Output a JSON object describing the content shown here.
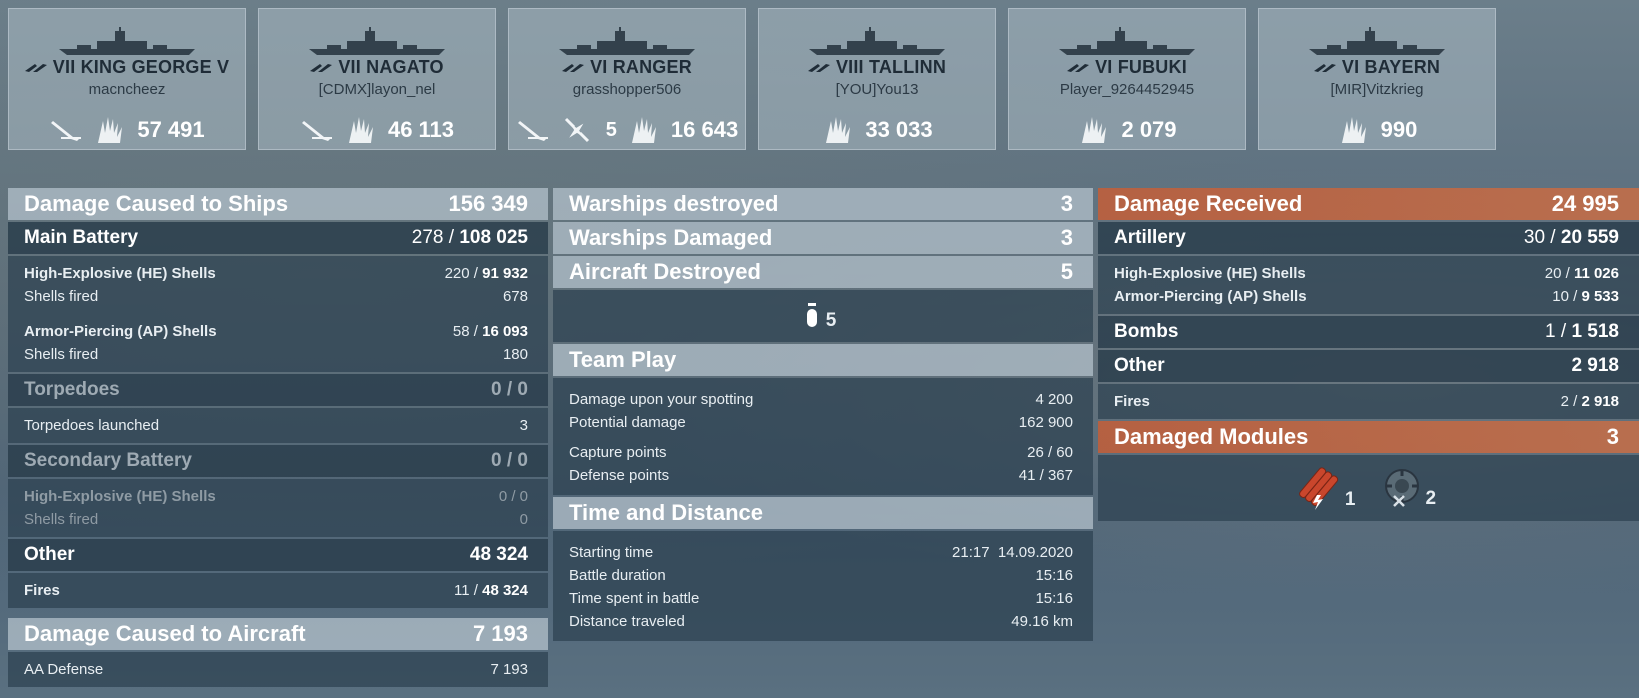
{
  "ships": [
    {
      "tier": "VII",
      "name": "KING GEORGE V",
      "player": "macncheez",
      "ribbons": [
        "torpedo-ribbon-icon",
        "fire-ribbon-icon"
      ],
      "damage": "57 491",
      "kills": null
    },
    {
      "tier": "VII",
      "name": "NAGATO",
      "player": "[CDMX]layon_nel",
      "ribbons": [
        "torpedo-ribbon-icon",
        "fire-ribbon-icon"
      ],
      "damage": "46 113",
      "kills": null
    },
    {
      "tier": "VI",
      "name": "RANGER",
      "player": "grasshopper506",
      "ribbons": [
        "torpedo-ribbon-icon",
        "aircraft-kill-icon",
        "fire-ribbon-icon"
      ],
      "damage": "16 643",
      "kills": "5"
    },
    {
      "tier": "VIII",
      "name": "TALLINN",
      "player": "[YOU]You13",
      "ribbons": [
        "fire-ribbon-icon"
      ],
      "damage": "33 033",
      "kills": null
    },
    {
      "tier": "VI",
      "name": "FUBUKI",
      "player": "Player_9264452945",
      "ribbons": [
        "fire-ribbon-icon"
      ],
      "damage": "2 079",
      "kills": null
    },
    {
      "tier": "VI",
      "name": "BAYERN",
      "player": "[MIR]Vitzkrieg",
      "ribbons": [
        "fire-ribbon-icon"
      ],
      "damage": "990",
      "kills": null
    }
  ],
  "left": {
    "header": {
      "title": "Damage Caused to Ships",
      "value": "156 349"
    },
    "main_battery": {
      "title": "Main Battery",
      "hits": "278 / ",
      "dmg": "108 025"
    },
    "he": {
      "label": "High-Explosive (HE) Shells",
      "hits": "220 / ",
      "dmg": "91 932",
      "fired_label": "Shells fired",
      "fired": "678"
    },
    "ap": {
      "label": "Armor-Piercing (AP) Shells",
      "hits": "58 / ",
      "dmg": "16 093",
      "fired_label": "Shells fired",
      "fired": "180"
    },
    "torpedoes": {
      "title": "Torpedoes",
      "value": "0 / 0",
      "launched_label": "Torpedoes launched",
      "launched": "3"
    },
    "secondary": {
      "title": "Secondary Battery",
      "value": "0 / 0",
      "he_label": "High-Explosive (HE) Shells",
      "he_value": "0 / 0",
      "fired_label": "Shells fired",
      "fired": "0"
    },
    "other": {
      "title": "Other",
      "value": "48 324",
      "fires_label": "Fires",
      "fires_hits": "11 / ",
      "fires_dmg": "48 324"
    },
    "aircraft": {
      "title": "Damage Caused to Aircraft",
      "value": "7 193",
      "aa_label": "AA Defense",
      "aa_value": "7 193"
    }
  },
  "middle": {
    "destroyed": {
      "title": "Warships destroyed",
      "value": "3"
    },
    "damaged": {
      "title": "Warships Damaged",
      "value": "3"
    },
    "aircraft": {
      "title": "Aircraft Destroyed",
      "value": "5",
      "icon": "plane-icon",
      "count": "5"
    },
    "team_play": {
      "title": "Team Play",
      "spotting_label": "Damage upon your spotting",
      "spotting": "4 200",
      "potential_label": "Potential damage",
      "potential": "162 900",
      "capture_label": "Capture points",
      "capture": "26 / 60",
      "defense_label": "Defense points",
      "defense": "41 / 367"
    },
    "time": {
      "title": "Time and Distance",
      "start_label": "Starting time",
      "start": "21:17  14.09.2020",
      "duration_label": "Battle duration",
      "duration": "15:16",
      "spent_label": "Time spent in battle",
      "spent": "15:16",
      "distance_label": "Distance traveled",
      "distance": "49.16 km"
    }
  },
  "right": {
    "received": {
      "title": "Damage Received",
      "value": "24 995"
    },
    "artillery": {
      "title": "Artillery",
      "hits": "30 / ",
      "dmg": "20 559",
      "he_label": "High-Explosive (HE) Shells",
      "he_hits": "20 / ",
      "he_dmg": "11 026",
      "ap_label": "Armor-Piercing (AP) Shells",
      "ap_hits": "10 / ",
      "ap_dmg": "9 533"
    },
    "bombs": {
      "title": "Bombs",
      "hits": "1 / ",
      "dmg": "1 518"
    },
    "other": {
      "title": "Other",
      "value": "2 918",
      "fires_label": "Fires",
      "fires_hits": "2 / ",
      "fires_dmg": "2 918"
    },
    "modules": {
      "title": "Damaged Modules",
      "value": "3",
      "items": [
        {
          "icon": "torpedo-tubes-icon",
          "count": "1"
        },
        {
          "icon": "aa-mount-icon",
          "count": "2"
        }
      ]
    }
  },
  "colors": {
    "header": "#afbec8",
    "received": "#be5f3c",
    "panel": "#2d4150"
  }
}
